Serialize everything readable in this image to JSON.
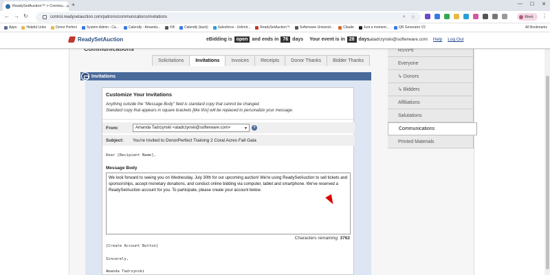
{
  "browser": {
    "tab_title": "ReadySetAuction™ > Commu...",
    "url": "control.readysetauction.com/patrons/communications/invitations",
    "profile_label": "Work",
    "bookmarks": [
      {
        "label": "Apps",
        "color": "#5b6b8a"
      },
      {
        "label": "Helpful Links",
        "color": "#e8b94a"
      },
      {
        "label": "Donor Perfect",
        "color": "#e8b94a"
      },
      {
        "label": "System Admin - Ca...",
        "color": "#3b78e7"
      },
      {
        "label": "Calendly - Amanda...",
        "color": "#3b78e7"
      },
      {
        "label": "KB",
        "color": "#555"
      },
      {
        "label": "Calendly (back)",
        "color": "#3b78e7"
      },
      {
        "label": "Salesforce - Unlimit...",
        "color": "#2a9fd8"
      },
      {
        "label": "ReadySetAuction™",
        "color": "#c0392b"
      },
      {
        "label": "Softerware Universit...",
        "color": "#555"
      },
      {
        "label": "Claude",
        "color": "#d2691e"
      },
      {
        "label": "Just a moment...",
        "color": "#222"
      },
      {
        "label": "QR Generator V2",
        "color": "#3b78e7"
      }
    ],
    "all_bookmarks": "All Bookmarks"
  },
  "header": {
    "logo": "ReadySetAuction",
    "ebidding_prefix": "eBidding is",
    "ebidding_status": "open",
    "ends_in_label": "and ends in",
    "ends_in_days": "76",
    "days_label": "days",
    "event_prefix": "Your event is in",
    "event_days": "28",
    "event_days_label": "days.",
    "user_email": "atadrzynski@softerware.com",
    "help": "Help",
    "logout": "Log Out"
  },
  "page_title": "Communications",
  "subtabs": [
    {
      "label": "Solicitations",
      "active": false
    },
    {
      "label": "Invitations",
      "active": true
    },
    {
      "label": "Invoices",
      "active": false
    },
    {
      "label": "Receipts",
      "active": false
    },
    {
      "label": "Donor Thanks",
      "active": false
    },
    {
      "label": "Bidder Thanks",
      "active": false
    }
  ],
  "section_title": "Invitations",
  "card": {
    "title": "Customize Your Invitations",
    "note_line1": "Anything outside the \"Message Body\" field is standard copy that cannot be changed.",
    "note_line2": "Standard copy that appears in square brackets [like this] will be replaced to personalize your message.",
    "from_label": "From:",
    "from_value": "Amanda Tadrzynski <atadrzynski@softerware.com>",
    "subject_label": "Subject:",
    "subject_value": "You're Invited to DonorPerfect Training 2 Coral Acres Fall Gala",
    "greeting": "Dear [Recipient Name],",
    "message_body_label": "Message Body",
    "message_body": "We look forward to seeing you on Wednesday, July 30th for our upcoming auction! We're using ReadySetAuction to sell tickets and sponsorships, accept monetary donations, and conduct online bidding via computer, tablet and smartphone. We've reserved a ReadySetAuction account for you. To participate, please create your account below.",
    "chars_label": "Characters remaining:",
    "chars_remaining": "3762",
    "create_button_placeholder": "[Create Account Button]",
    "closing": "Sincerely,",
    "signature": "Amanda Tadrzynski"
  },
  "right_nav": [
    {
      "label": "RSVPs",
      "active": false
    },
    {
      "label": "Everyone",
      "active": false
    },
    {
      "label": "↳ Donors",
      "active": false
    },
    {
      "label": "↳ Bidders",
      "active": false
    },
    {
      "label": "Affiliations",
      "active": false
    },
    {
      "label": "Salutations",
      "active": false
    },
    {
      "label": "Communications",
      "active": true
    },
    {
      "label": "Printed Materials",
      "active": false
    }
  ]
}
